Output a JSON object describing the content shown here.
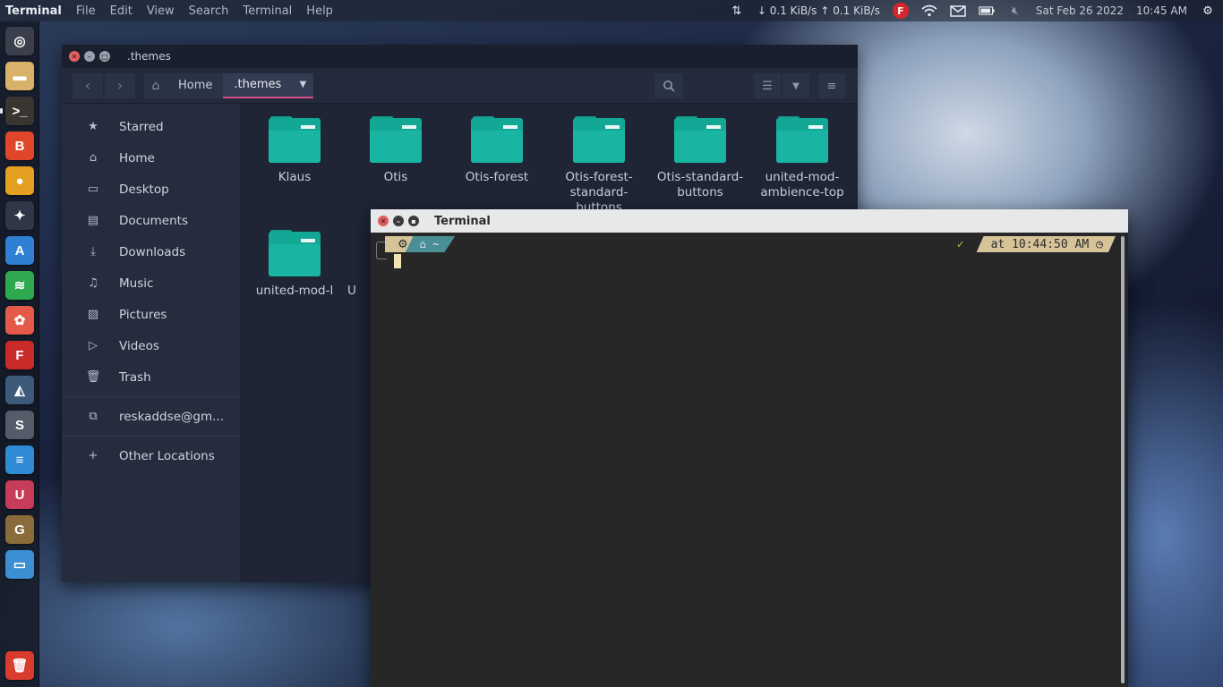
{
  "top_panel": {
    "menus": [
      "Terminal",
      "File",
      "Edit",
      "View",
      "Search",
      "Terminal",
      "Help"
    ],
    "net_down": "↓ 0.1 KiB/s",
    "net_up": "↑ 0.1 KiB/s",
    "datetime": "Sat Feb 26 2022",
    "time": "10:45 AM"
  },
  "launcher": {
    "apps": [
      {
        "name": "ubuntu-dash",
        "color": "#3a3f4b",
        "glyph": "◎"
      },
      {
        "name": "files",
        "color": "#d8b26a",
        "glyph": "▬"
      },
      {
        "name": "terminal",
        "color": "#3a3530",
        "glyph": ">_"
      },
      {
        "name": "brave",
        "color": "#e0472a",
        "glyph": "B"
      },
      {
        "name": "chrome",
        "color": "#e3a021",
        "glyph": "●"
      },
      {
        "name": "game",
        "color": "#2f3645",
        "glyph": "✦"
      },
      {
        "name": "app-a",
        "color": "#2f7fd4",
        "glyph": "A"
      },
      {
        "name": "spotify",
        "color": "#2ea94f",
        "glyph": "≋"
      },
      {
        "name": "ubuntu-software",
        "color": "#e35b48",
        "glyph": "✿"
      },
      {
        "name": "app-red",
        "color": "#c92a2a",
        "glyph": "F"
      },
      {
        "name": "unity-3d",
        "color": "#3d5a7a",
        "glyph": "◭"
      },
      {
        "name": "app-s",
        "color": "#555c69",
        "glyph": "S"
      },
      {
        "name": "layers",
        "color": "#2f8bd6",
        "glyph": "≡"
      },
      {
        "name": "app-u",
        "color": "#c73c58",
        "glyph": "U"
      },
      {
        "name": "gimp",
        "color": "#8a6b3a",
        "glyph": "G"
      },
      {
        "name": "display",
        "color": "#3b8fd2",
        "glyph": "▭"
      }
    ],
    "trash": {
      "name": "trash",
      "color": "#d93b2e",
      "glyph": "🗑"
    }
  },
  "file_manager": {
    "title": ".themes",
    "path": {
      "home": "Home",
      "current": ".themes"
    },
    "sidebar": [
      {
        "label": "Starred",
        "icon": "★"
      },
      {
        "label": "Home",
        "icon": "⌂"
      },
      {
        "label": "Desktop",
        "icon": "▭"
      },
      {
        "label": "Documents",
        "icon": "▤"
      },
      {
        "label": "Downloads",
        "icon": "⤓"
      },
      {
        "label": "Music",
        "icon": "♫"
      },
      {
        "label": "Pictures",
        "icon": "▨"
      },
      {
        "label": "Videos",
        "icon": "▷"
      },
      {
        "label": "Trash",
        "icon": "🗑"
      }
    ],
    "account": {
      "label": "reskaddse@gm...",
      "icon": "⧉"
    },
    "other_locations": {
      "label": "Other Locations",
      "icon": "+"
    },
    "folders": [
      {
        "label": "Klaus"
      },
      {
        "label": "Otis"
      },
      {
        "label": "Otis-forest"
      },
      {
        "label": "Otis-forest-standard-buttons"
      },
      {
        "label": "Otis-standard-buttons"
      },
      {
        "label": "united-mod-ambience-top"
      },
      {
        "label": "united-mod-l"
      },
      {
        "label": "U"
      }
    ]
  },
  "terminal": {
    "title": "Terminal",
    "os_glyph": "⚙",
    "cwd": "⌂ ~",
    "status": "✓",
    "time": "at 10:44:50 AM",
    "clock_glyph": "◷"
  }
}
